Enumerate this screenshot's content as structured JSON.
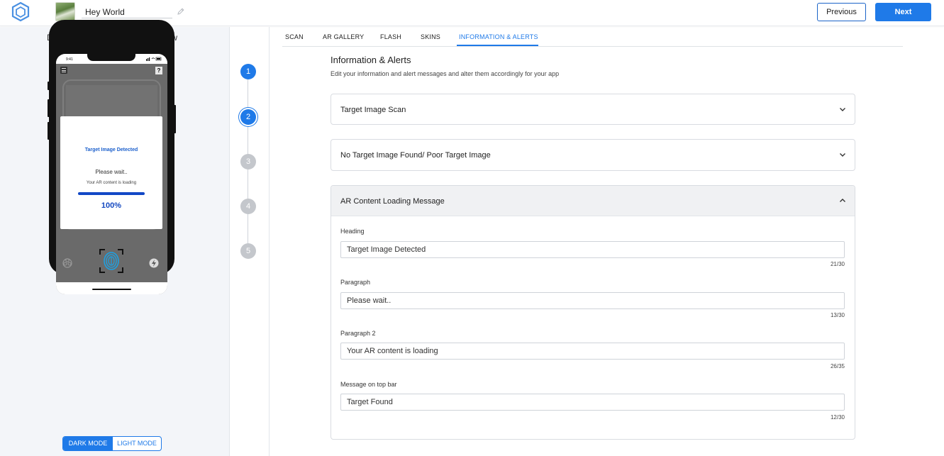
{
  "header": {
    "project_name": "Hey World",
    "previous_label": "Previous",
    "next_label": "Next"
  },
  "preview": {
    "title": "Demo of the AR camera scan view",
    "status_time": "9:41",
    "help_glyph": "?",
    "popup": {
      "heading": "Target Image Detected",
      "paragraph": "Please wait..",
      "paragraph2": "Your AR content is loading",
      "progress_text": "100%",
      "progress": 1.0
    },
    "mode_toggle": {
      "dark_label": "DARK MODE",
      "light_label": "LIGHT MODE",
      "selected": "dark"
    }
  },
  "stepper": {
    "steps": [
      {
        "label": "1",
        "state": "done"
      },
      {
        "label": "2",
        "state": "current"
      },
      {
        "label": "3",
        "state": "inactive"
      },
      {
        "label": "4",
        "state": "inactive"
      },
      {
        "label": "5",
        "state": "inactive"
      }
    ]
  },
  "tabs": [
    {
      "label": "SCAN"
    },
    {
      "label": "AR GALLERY"
    },
    {
      "label": "FLASH"
    },
    {
      "label": "SKINS"
    },
    {
      "label": "INFORMATION & ALERTS",
      "active": true
    }
  ],
  "section": {
    "title": "Information & Alerts",
    "subtitle": "Edit your information and alert messages and alter them accordingly for your app"
  },
  "accordions": [
    {
      "label": "Target Image Scan",
      "expanded": false
    },
    {
      "label": "No Target Image Found/ Poor Target Image",
      "expanded": false
    },
    {
      "label": "AR Content Loading Message",
      "expanded": true
    }
  ],
  "fields": [
    {
      "label": "Heading",
      "value": "Target Image Detected",
      "count": "21/30"
    },
    {
      "label": "Paragraph",
      "value": "Please wait..",
      "count": "13/30"
    },
    {
      "label": "Paragraph 2",
      "value": "Your AR content is loading",
      "count": "26/35"
    },
    {
      "label": "Message on top bar",
      "value": "Target Found",
      "count": "12/30"
    }
  ],
  "colors": {
    "accent": "#1f7ae8",
    "inactive_step": "#c4c7cc",
    "left_panel_bg": "#f3f5f9"
  }
}
